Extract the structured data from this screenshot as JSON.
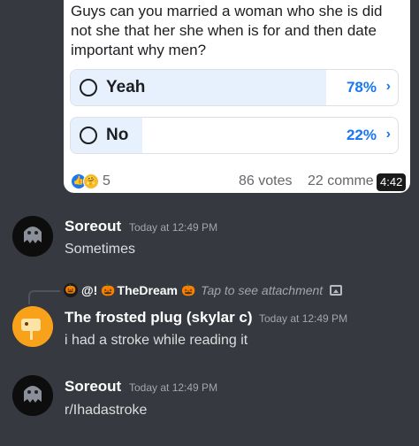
{
  "poll": {
    "question": "Guys can you married a woman who she is did not she that her she when is for and then date important why men?",
    "options": [
      {
        "label": "Yeah",
        "percent": "78%",
        "fill": 0.78
      },
      {
        "label": "No",
        "percent": "22%",
        "fill": 0.22
      }
    ],
    "reaction_count": "5",
    "votes": "86 votes",
    "comments": "22 comme",
    "video_time": "4:42",
    "accent": "#1877f2"
  },
  "messages": [
    {
      "username": "Soreout",
      "timestamp": "Today at 12:49 PM",
      "text": "Sometimes"
    },
    {
      "reply": {
        "prefix": "@!",
        "name": "TheDream",
        "tap_text": "Tap to see attachment"
      },
      "username": "The frosted plug (skylar c)",
      "timestamp": "Today at 12:49 PM",
      "text": "i had a stroke while reading it"
    },
    {
      "username": "Soreout",
      "timestamp": "Today at 12:49 PM",
      "text": "r/Ihadastroke"
    }
  ],
  "colors": {
    "background": "#36393f",
    "username": "#ffffff",
    "timestamp": "#a3a6aa",
    "message": "#dcddde"
  }
}
